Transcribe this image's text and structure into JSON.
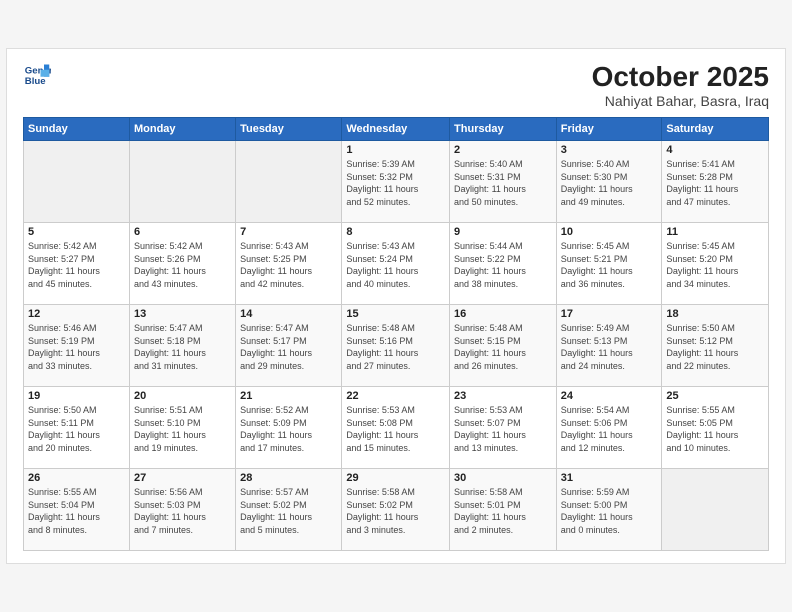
{
  "header": {
    "logo_line1": "General",
    "logo_line2": "Blue",
    "month_year": "October 2025",
    "location": "Nahiyat Bahar, Basra, Iraq"
  },
  "days_of_week": [
    "Sunday",
    "Monday",
    "Tuesday",
    "Wednesday",
    "Thursday",
    "Friday",
    "Saturday"
  ],
  "weeks": [
    [
      {
        "day": "",
        "info": ""
      },
      {
        "day": "",
        "info": ""
      },
      {
        "day": "",
        "info": ""
      },
      {
        "day": "1",
        "info": "Sunrise: 5:39 AM\nSunset: 5:32 PM\nDaylight: 11 hours\nand 52 minutes."
      },
      {
        "day": "2",
        "info": "Sunrise: 5:40 AM\nSunset: 5:31 PM\nDaylight: 11 hours\nand 50 minutes."
      },
      {
        "day": "3",
        "info": "Sunrise: 5:40 AM\nSunset: 5:30 PM\nDaylight: 11 hours\nand 49 minutes."
      },
      {
        "day": "4",
        "info": "Sunrise: 5:41 AM\nSunset: 5:28 PM\nDaylight: 11 hours\nand 47 minutes."
      }
    ],
    [
      {
        "day": "5",
        "info": "Sunrise: 5:42 AM\nSunset: 5:27 PM\nDaylight: 11 hours\nand 45 minutes."
      },
      {
        "day": "6",
        "info": "Sunrise: 5:42 AM\nSunset: 5:26 PM\nDaylight: 11 hours\nand 43 minutes."
      },
      {
        "day": "7",
        "info": "Sunrise: 5:43 AM\nSunset: 5:25 PM\nDaylight: 11 hours\nand 42 minutes."
      },
      {
        "day": "8",
        "info": "Sunrise: 5:43 AM\nSunset: 5:24 PM\nDaylight: 11 hours\nand 40 minutes."
      },
      {
        "day": "9",
        "info": "Sunrise: 5:44 AM\nSunset: 5:22 PM\nDaylight: 11 hours\nand 38 minutes."
      },
      {
        "day": "10",
        "info": "Sunrise: 5:45 AM\nSunset: 5:21 PM\nDaylight: 11 hours\nand 36 minutes."
      },
      {
        "day": "11",
        "info": "Sunrise: 5:45 AM\nSunset: 5:20 PM\nDaylight: 11 hours\nand 34 minutes."
      }
    ],
    [
      {
        "day": "12",
        "info": "Sunrise: 5:46 AM\nSunset: 5:19 PM\nDaylight: 11 hours\nand 33 minutes."
      },
      {
        "day": "13",
        "info": "Sunrise: 5:47 AM\nSunset: 5:18 PM\nDaylight: 11 hours\nand 31 minutes."
      },
      {
        "day": "14",
        "info": "Sunrise: 5:47 AM\nSunset: 5:17 PM\nDaylight: 11 hours\nand 29 minutes."
      },
      {
        "day": "15",
        "info": "Sunrise: 5:48 AM\nSunset: 5:16 PM\nDaylight: 11 hours\nand 27 minutes."
      },
      {
        "day": "16",
        "info": "Sunrise: 5:48 AM\nSunset: 5:15 PM\nDaylight: 11 hours\nand 26 minutes."
      },
      {
        "day": "17",
        "info": "Sunrise: 5:49 AM\nSunset: 5:13 PM\nDaylight: 11 hours\nand 24 minutes."
      },
      {
        "day": "18",
        "info": "Sunrise: 5:50 AM\nSunset: 5:12 PM\nDaylight: 11 hours\nand 22 minutes."
      }
    ],
    [
      {
        "day": "19",
        "info": "Sunrise: 5:50 AM\nSunset: 5:11 PM\nDaylight: 11 hours\nand 20 minutes."
      },
      {
        "day": "20",
        "info": "Sunrise: 5:51 AM\nSunset: 5:10 PM\nDaylight: 11 hours\nand 19 minutes."
      },
      {
        "day": "21",
        "info": "Sunrise: 5:52 AM\nSunset: 5:09 PM\nDaylight: 11 hours\nand 17 minutes."
      },
      {
        "day": "22",
        "info": "Sunrise: 5:53 AM\nSunset: 5:08 PM\nDaylight: 11 hours\nand 15 minutes."
      },
      {
        "day": "23",
        "info": "Sunrise: 5:53 AM\nSunset: 5:07 PM\nDaylight: 11 hours\nand 13 minutes."
      },
      {
        "day": "24",
        "info": "Sunrise: 5:54 AM\nSunset: 5:06 PM\nDaylight: 11 hours\nand 12 minutes."
      },
      {
        "day": "25",
        "info": "Sunrise: 5:55 AM\nSunset: 5:05 PM\nDaylight: 11 hours\nand 10 minutes."
      }
    ],
    [
      {
        "day": "26",
        "info": "Sunrise: 5:55 AM\nSunset: 5:04 PM\nDaylight: 11 hours\nand 8 minutes."
      },
      {
        "day": "27",
        "info": "Sunrise: 5:56 AM\nSunset: 5:03 PM\nDaylight: 11 hours\nand 7 minutes."
      },
      {
        "day": "28",
        "info": "Sunrise: 5:57 AM\nSunset: 5:02 PM\nDaylight: 11 hours\nand 5 minutes."
      },
      {
        "day": "29",
        "info": "Sunrise: 5:58 AM\nSunset: 5:02 PM\nDaylight: 11 hours\nand 3 minutes."
      },
      {
        "day": "30",
        "info": "Sunrise: 5:58 AM\nSunset: 5:01 PM\nDaylight: 11 hours\nand 2 minutes."
      },
      {
        "day": "31",
        "info": "Sunrise: 5:59 AM\nSunset: 5:00 PM\nDaylight: 11 hours\nand 0 minutes."
      },
      {
        "day": "",
        "info": ""
      }
    ]
  ]
}
